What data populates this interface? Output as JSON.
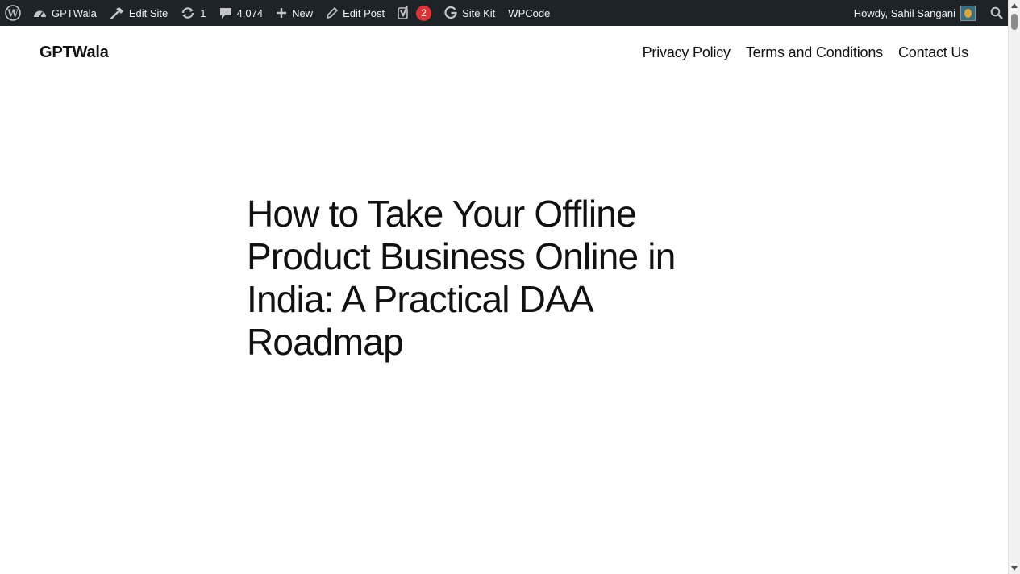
{
  "admin_bar": {
    "wp_logo_icon": "wordpress-logo-icon",
    "site_name": "GPTWala",
    "edit_site_label": "Edit Site",
    "updates_count": "1",
    "comments_count": "4,074",
    "new_label": "New",
    "edit_post_label": "Edit Post",
    "yoast_badge": "2",
    "site_kit_label": "Site Kit",
    "wpcode_label": "WPCode",
    "howdy_text": "Howdy, Sahil Sangani",
    "colors": {
      "bar_bg": "#1d2327",
      "text": "#f0f0f1",
      "badge_bg": "#d63638"
    }
  },
  "site": {
    "title": "GPTWala",
    "nav": [
      {
        "label": "Privacy Policy"
      },
      {
        "label": "Terms and Conditions"
      },
      {
        "label": "Contact Us"
      }
    ]
  },
  "post": {
    "title": "How to Take Your Offline Product Business Online in India: A Practical DAA Roadmap"
  }
}
